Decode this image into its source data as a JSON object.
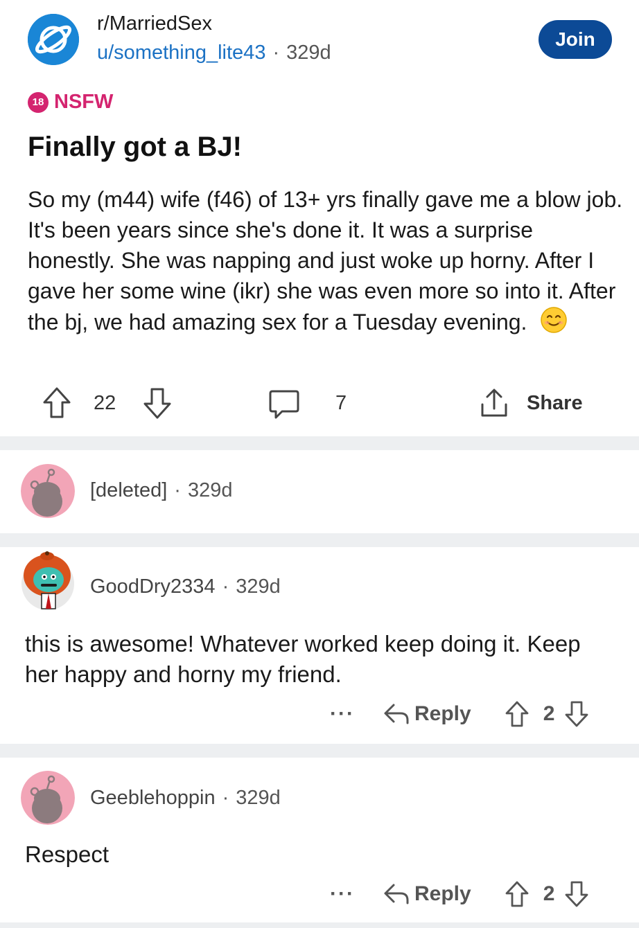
{
  "post": {
    "subreddit": "r/MarriedSex",
    "author": "u/something_lite43",
    "separator": "·",
    "age": "329d",
    "join_label": "Join",
    "nsfw_badge": "18",
    "nsfw_label": "NSFW",
    "title": "Finally got a BJ!",
    "body": "So my (m44) wife (f46) of 13+ yrs finally gave me a blow job. It's been years since she's done it. It was a surprise honestly. She was napping and just woke up horny. After I gave her some wine (ikr) she was even more so into it. After the bj, we had amazing sex for a Tuesday evening.",
    "emoji": "smiling-face-icon",
    "score": "22",
    "comment_count": "7",
    "share_label": "Share"
  },
  "comments": [
    {
      "username": "[deleted]",
      "separator": "·",
      "age": "329d",
      "avatar": "default-snoo-pink"
    },
    {
      "username": "GoodDry2334",
      "separator": "·",
      "age": "329d",
      "avatar": "custom-snoo-helmet",
      "text": "this is awesome! Whatever worked keep doing it. Keep her happy and horny my friend.",
      "more_label": "···",
      "reply_label": "Reply",
      "score": "2"
    },
    {
      "username": "Geeblehoppin",
      "separator": "·",
      "age": "329d",
      "avatar": "default-snoo-pink",
      "text": "Respect",
      "more_label": "···",
      "reply_label": "Reply",
      "score": "2"
    }
  ],
  "colors": {
    "accent_blue": "#0c4a96",
    "link_blue": "#1c72c4",
    "nsfw_pink": "#d4246f",
    "separator_gray": "#edeff1",
    "avatar_pink": "#f2a5b7"
  }
}
